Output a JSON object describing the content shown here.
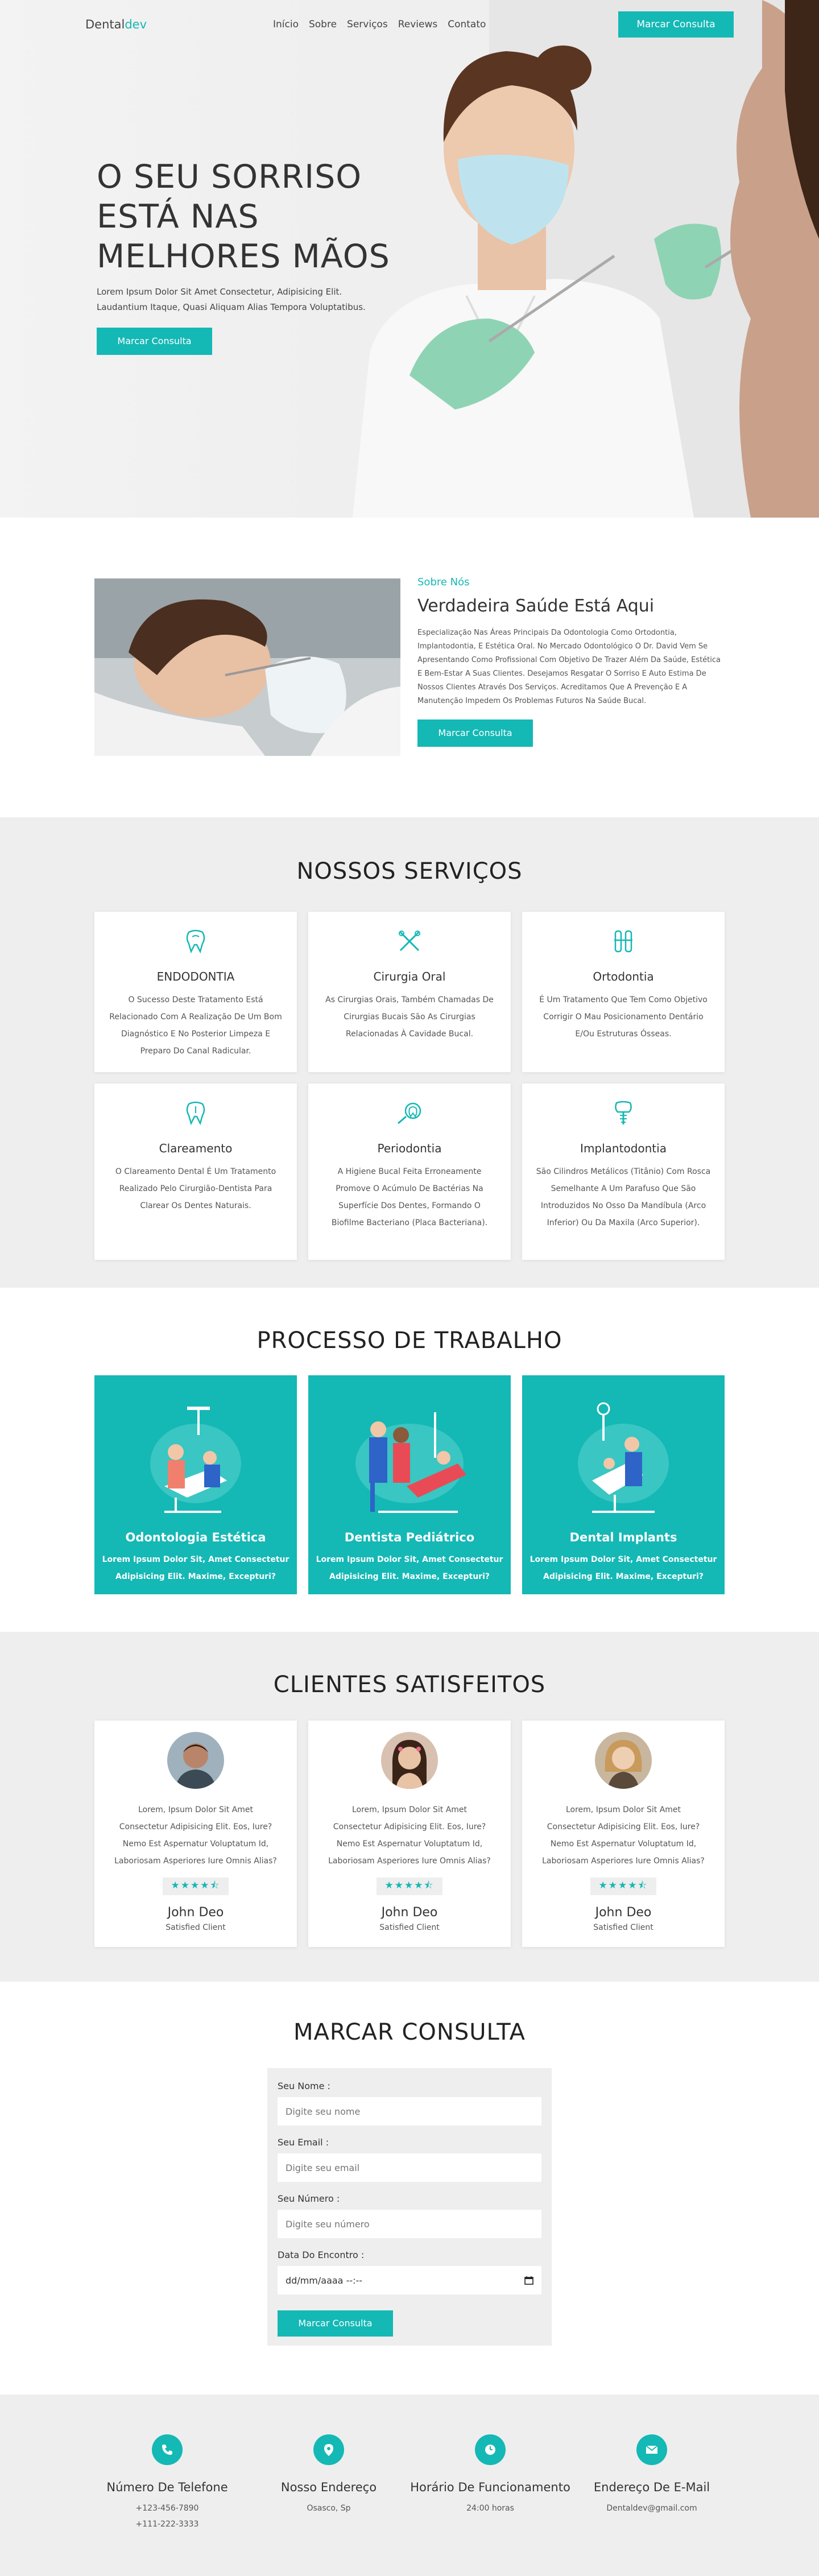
{
  "header": {
    "logo_part1": "Dental",
    "logo_part2": "dev",
    "nav": [
      "Início",
      "Sobre",
      "Serviços",
      "Reviews",
      "Contato"
    ],
    "cta": "Marcar Consulta"
  },
  "hero": {
    "title_lines": [
      "O SEU SORRISO",
      "ESTÁ NAS",
      "MELHORES MÃOS"
    ],
    "subtitle": "Lorem Ipsum Dolor Sit Amet Consectetur, Adipisicing Elit. Laudantium Itaque, Quasi Aliquam Alias Tempora Voluptatibus.",
    "cta": "Marcar Consulta"
  },
  "about": {
    "kicker": "Sobre Nós",
    "title": "Verdadeira Saúde Está Aqui",
    "desc": "Especialização Nas Áreas Principais Da Odontologia Como Ortodontia, Implantodontia, E Estética Oral. No Mercado Odontológico O Dr. David Vem Se Apresentando Como Profissional Com Objetivo De Trazer Além Da Saúde, Estética E Bem-Estar A Suas Clientes. Desejamos Resgatar O Sorriso E Auto Estima De Nossos Clientes Através Dos Serviços. Acreditamos Que A Prevenção E A Manutenção Impedem Os Problemas Futuros Na Saúde Bucal.",
    "cta": "Marcar Consulta"
  },
  "services": {
    "title": "NOSSOS SERVIÇOS",
    "items": [
      {
        "name": "ENDODONTIA",
        "desc": "O Sucesso Deste Tratamento Está Relacionado Com A Realização De Um Bom Diagnóstico E No Posterior Limpeza E Preparo Do Canal Radicular.",
        "icon": "tooth-root-icon"
      },
      {
        "name": "Cirurgia Oral",
        "desc": "As Cirurgias Orais, Também Chamadas De Cirurgias Bucais São As Cirurgias Relacionadas À Cavidade Bucal.",
        "icon": "surgery-tools-icon"
      },
      {
        "name": "Ortodontia",
        "desc": "É Um Tratamento Que Tem Como Objetivo Corrigir O Mau Posicionamento Dentário E/Ou Estruturas Ósseas.",
        "icon": "braces-icon"
      },
      {
        "name": "Clareamento",
        "desc": "O Clareamento Dental É Um Tratamento Realizado Pelo Cirurgião-Dentista Para Clarear Os Dentes Naturais.",
        "icon": "tooth-icon"
      },
      {
        "name": "Periodontia",
        "desc": "A Higiene Bucal Feita Erroneamente Promove O Acúmulo De Bactérias Na Superfície Dos Dentes, Formando O Biofilme Bacteriano (Placa Bacteriana).",
        "icon": "gum-icon"
      },
      {
        "name": "Implantodontia",
        "desc": "São Cilindros Metálicos (Titânio) Com Rosca Semelhante A Um Parafuso Que São Introduzidos No Osso Da Mandíbula (Arco Inferior) Ou Da Maxila (Arco Superior).",
        "icon": "implant-icon"
      }
    ]
  },
  "process": {
    "title": "PROCESSO DE TRABALHO",
    "items": [
      {
        "name": "Odontologia Estética",
        "desc": "Lorem Ipsum Dolor Sit, Amet Consectetur Adipisicing Elit. Maxime, Excepturi?"
      },
      {
        "name": "Dentista Pediátrico",
        "desc": "Lorem Ipsum Dolor Sit, Amet Consectetur Adipisicing Elit. Maxime, Excepturi?"
      },
      {
        "name": "Dental Implants",
        "desc": "Lorem Ipsum Dolor Sit, Amet Consectetur Adipisicing Elit. Maxime, Excepturi?"
      }
    ]
  },
  "clients": {
    "title": "CLIENTES SATISFEITOS",
    "items": [
      {
        "quote": "Lorem, Ipsum Dolor Sit Amet Consectetur Adipisicing Elit. Eos, Iure? Nemo Est Aspernatur Voluptatum Id, Laboriosam Asperiores Iure Omnis Alias?",
        "stars": "★★★★⯪",
        "name": "John Deo",
        "role": "Satisfied Client"
      },
      {
        "quote": "Lorem, Ipsum Dolor Sit Amet Consectetur Adipisicing Elit. Eos, Iure? Nemo Est Aspernatur Voluptatum Id, Laboriosam Asperiores Iure Omnis Alias?",
        "stars": "★★★★⯪",
        "name": "John Deo",
        "role": "Satisfied Client"
      },
      {
        "quote": "Lorem, Ipsum Dolor Sit Amet Consectetur Adipisicing Elit. Eos, Iure? Nemo Est Aspernatur Voluptatum Id, Laboriosam Asperiores Iure Omnis Alias?",
        "stars": "★★★★⯪",
        "name": "John Deo",
        "role": "Satisfied Client"
      }
    ]
  },
  "booking": {
    "title": "MARCAR CONSULTA",
    "name_label": "Seu Nome :",
    "name_ph": "Digite seu nome",
    "email_label": "Seu Email :",
    "email_ph": "Digite seu email",
    "phone_label": "Seu Número :",
    "phone_ph": "Digite seu número",
    "date_label": "Data Do Encontro :",
    "date_ph": "dd/mm/aaaa --:--",
    "cta": "Marcar Consulta"
  },
  "footer": {
    "cols": [
      {
        "title": "Número De Telefone",
        "lines": [
          "+123-456-7890",
          "+111-222-3333"
        ],
        "icon": "phone-icon"
      },
      {
        "title": "Nosso Endereço",
        "lines": [
          "Osasco, Sp"
        ],
        "icon": "location-pin-icon"
      },
      {
        "title": "Horário De Funcionamento",
        "lines": [
          "24:00 horas"
        ],
        "icon": "clock-icon"
      },
      {
        "title": "Endereço De E-Mail",
        "lines": [
          "Dentaldev@gmail.com"
        ],
        "icon": "envelope-icon"
      }
    ]
  },
  "colors": {
    "accent": "#14b8b5",
    "section_gray": "#eeeeee",
    "text_dark": "#333333"
  }
}
